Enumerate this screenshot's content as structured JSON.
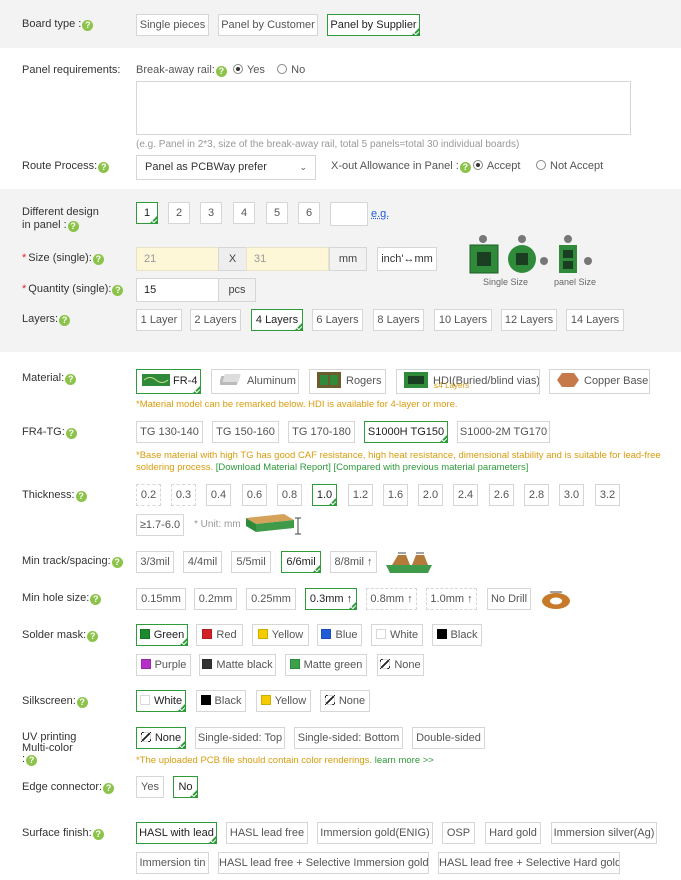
{
  "board_type": {
    "label": "Board type :",
    "options": [
      "Single pieces",
      "Panel by Customer",
      "Panel by Supplier"
    ]
  },
  "panel": {
    "label": "Panel requirements:",
    "rail_label": "Break-away rail:",
    "rail_yes": "Yes",
    "rail_no": "No",
    "textarea_hint": "(e.g. Panel in 2*3, size of the break-away rail, total 5 panels=total 30 individual boards)"
  },
  "route": {
    "label": "Route Process:",
    "select_value": "Panel as PCBWay prefer",
    "xout_label": "X-out Allowance in Panel :",
    "accept": "Accept",
    "not_accept": "Not Accept"
  },
  "design": {
    "label_line1": "Different design",
    "label_line2": "in panel :",
    "options": [
      "1",
      "2",
      "3",
      "4",
      "5",
      "6"
    ],
    "eg": "e.g."
  },
  "size": {
    "label": "Size (single):",
    "width": "21",
    "x": "X",
    "height": "31",
    "unit": "mm",
    "toggle": "inch'↔mm",
    "caption_single": "Single Size",
    "caption_panel": "panel Size"
  },
  "quantity": {
    "label": "Quantity (single):",
    "value": "15",
    "unit": "pcs"
  },
  "layers": {
    "label": "Layers:",
    "options": [
      "1 Layer",
      "2 Layers",
      "4 Layers",
      "6 Layers",
      "8 Layers",
      "10 Layers",
      "12 Layers",
      "14 Layers"
    ]
  },
  "material": {
    "label": "Material:",
    "options": [
      "FR-4",
      "Aluminum",
      "Rogers",
      "HDI(Buried/blind vias)",
      "Copper Base"
    ],
    "hdi_sub": "≤4 Layers",
    "note": "*Material model can be remarked below. HDI is available for 4-layer or more."
  },
  "tg": {
    "label": "FR4-TG:",
    "options": [
      "TG 130-140",
      "TG 150-160",
      "TG 170-180",
      "S1000H TG150",
      "S1000-2M TG170"
    ],
    "note1": "*Base material with high TG has good CAF resistance, high heat resistance, dimensional stability and is suitable for lead-free",
    "note2": "soldering process.",
    "link1": "[Download Material Report]",
    "link2": "[Compared with previous material parameters]"
  },
  "thickness": {
    "label": "Thickness:",
    "options": [
      "0.2",
      "0.3",
      "0.4",
      "0.6",
      "0.8",
      "1.0",
      "1.2",
      "1.6",
      "2.0",
      "2.4",
      "2.6",
      "2.8",
      "3.0",
      "3.2",
      "≥1.7-6.0"
    ],
    "unit_note": "* Unit: mm"
  },
  "track": {
    "label": "Min track/spacing:",
    "options": [
      "3/3mil",
      "4/4mil",
      "5/5mil",
      "6/6mil",
      "8/8mil ↑"
    ]
  },
  "hole": {
    "label": "Min hole size:",
    "options": [
      "0.15mm",
      "0.2mm",
      "0.25mm",
      "0.3mm ↑",
      "0.8mm ↑",
      "1.0mm ↑",
      "No Drill"
    ]
  },
  "solder": {
    "label": "Solder mask:",
    "options": [
      {
        "name": "Green",
        "color": "#1a8a2c"
      },
      {
        "name": "Red",
        "color": "#d32027"
      },
      {
        "name": "Yellow",
        "color": "#f4cc00"
      },
      {
        "name": "Blue",
        "color": "#1f5ad8"
      },
      {
        "name": "White",
        "color": "#ffffff"
      },
      {
        "name": "Black",
        "color": "#000000"
      },
      {
        "name": "Purple",
        "color": "#b42fc6"
      },
      {
        "name": "Matte black",
        "color": "#333333"
      },
      {
        "name": "Matte green",
        "color": "#3aa04a"
      },
      {
        "name": "None",
        "color": "none"
      }
    ]
  },
  "silk": {
    "label": "Silkscreen:",
    "options": [
      {
        "name": "White",
        "color": "#ffffff"
      },
      {
        "name": "Black",
        "color": "#000000"
      },
      {
        "name": "Yellow",
        "color": "#f4cc00"
      },
      {
        "name": "None",
        "color": "none"
      }
    ]
  },
  "uv": {
    "label_line1": "UV printing",
    "label_line2": "Multi-color",
    "label_line3": ":",
    "options": [
      "None",
      "Single-sided: Top",
      "Single-sided: Bottom",
      "Double-sided"
    ],
    "note": "*The uploaded PCB file should contain color renderings.",
    "learn": "learn more >>"
  },
  "edge": {
    "label": "Edge connector:",
    "options": [
      "Yes",
      "No"
    ]
  },
  "surface": {
    "label": "Surface finish:",
    "options": [
      "HASL with lead",
      "HASL lead free",
      "Immersion gold(ENIG)",
      "OSP",
      "Hard gold",
      "Immersion silver(Ag)",
      "Immersion tin",
      "HASL lead free + Selective Immersion gold",
      "HASL lead free + Selective Hard gold"
    ]
  },
  "colors": {
    "accent": "#2e9a3a",
    "note": "#d89c0e",
    "help": "#8cc34a"
  }
}
